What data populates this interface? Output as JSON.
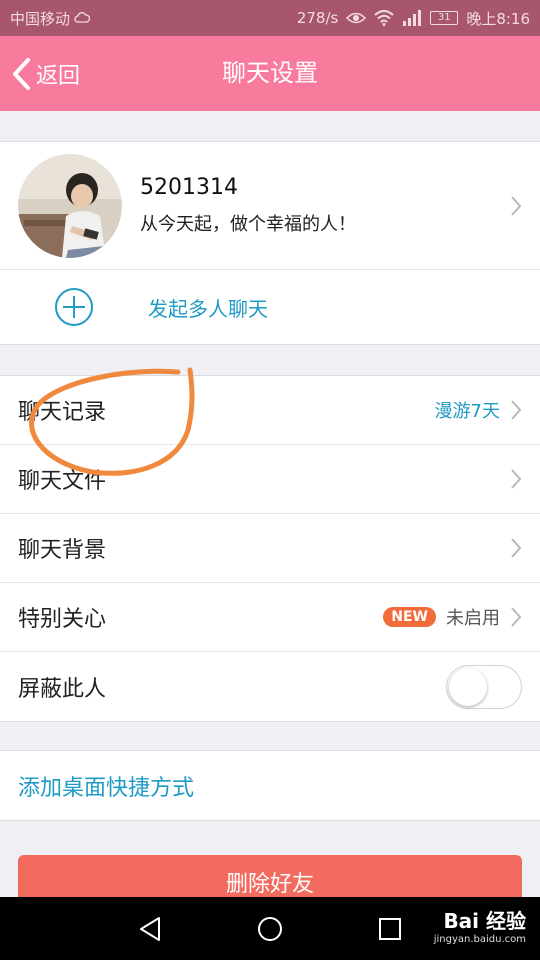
{
  "status_bar": {
    "carrier": "中国移动",
    "speed": "278/s",
    "battery": "31",
    "time": "晚上8:16"
  },
  "header": {
    "back_label": "返回",
    "title": "聊天设置"
  },
  "profile": {
    "name": "5201314",
    "motto": "从今天起，做个幸福的人！"
  },
  "group_chat": {
    "label": "发起多人聊天"
  },
  "settings": {
    "history": {
      "label": "聊天记录",
      "value": "漫游7天"
    },
    "files": {
      "label": "聊天文件"
    },
    "background": {
      "label": "聊天背景"
    },
    "special_care": {
      "label": "特别关心",
      "badge": "NEW",
      "value": "未启用"
    },
    "block": {
      "label": "屏蔽此人",
      "enabled": false
    }
  },
  "shortcut": {
    "label": "添加桌面快捷方式"
  },
  "delete_button": {
    "label": "删除好友"
  },
  "watermark": {
    "brand": "Bai 经验",
    "url": "jingyan.baidu.com"
  },
  "colors": {
    "status_bar": "#a7566d",
    "header": "#f87a9c",
    "link_blue": "#1f9bc4",
    "delete": "#f26b5e",
    "new_badge": "#f26b3a",
    "annotation": "#f0883e"
  }
}
